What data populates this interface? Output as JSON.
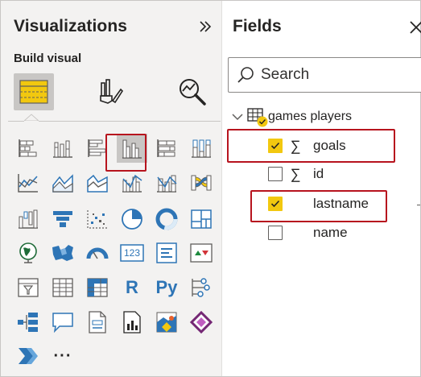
{
  "visualizations": {
    "title": "Visualizations",
    "collapse_icon": "double-chevron-right-icon",
    "build_label": "Build visual",
    "modes": [
      {
        "name": "build-visual",
        "icon": "build-visual-icon",
        "active": true
      },
      {
        "name": "format-visual",
        "icon": "paintbrush-icon",
        "active": false
      },
      {
        "name": "analytics",
        "icon": "analytics-magnifier-icon",
        "active": false
      }
    ],
    "grid": [
      [
        "stacked-bar-chart-icon",
        "stacked-column-chart-icon",
        "clustered-bar-chart-icon",
        "clustered-column-chart-icon",
        "100-stacked-bar-chart-icon",
        "100-stacked-column-chart-icon"
      ],
      [
        "line-chart-icon",
        "area-chart-icon",
        "stacked-area-chart-icon",
        "line-clustered-column-chart-icon",
        "line-stacked-column-chart-icon",
        "ribbon-chart-icon"
      ],
      [
        "waterfall-chart-icon",
        "funnel-icon",
        "scatter-chart-icon",
        "pie-chart-icon",
        "donut-chart-icon",
        "treemap-icon"
      ],
      [
        "map-icon",
        "filled-map-icon",
        "gauge-icon",
        "card-icon",
        "multi-row-card-icon",
        "kpi-icon"
      ],
      [
        "slicer-icon",
        "table-icon",
        "matrix-icon",
        "r-visual-icon",
        "python-visual-icon",
        "key-influencers-icon"
      ],
      [
        "decomposition-tree-icon",
        "qa-icon",
        "paginated-report-icon",
        "smart-narrative-icon",
        "arcgis-map-icon",
        "power-apps-icon"
      ],
      [
        "power-automate-icon",
        "more-visuals-icon"
      ]
    ],
    "r_label": "R",
    "py_label": "Py",
    "card_label": "123",
    "more_label": "···",
    "selected": "clustered-column-chart-icon"
  },
  "fields": {
    "title": "Fields",
    "close_icon": "close-icon",
    "search": {
      "placeholder": "Search",
      "value": ""
    },
    "table": {
      "name": "games players",
      "icon": "table-icon",
      "expanded": true
    },
    "items": [
      {
        "label": "goals",
        "sigma": "∑",
        "checked": true
      },
      {
        "label": "id",
        "sigma": "∑",
        "checked": false
      },
      {
        "label": "lastname",
        "sigma": "",
        "checked": true
      },
      {
        "label": "name",
        "sigma": "",
        "checked": false
      }
    ]
  },
  "colors": {
    "accent_yellow": "#f2c80f",
    "highlight_red": "#b7141e",
    "icon_blue": "#2e75b6",
    "pane_bg": "#f3f2f1"
  }
}
